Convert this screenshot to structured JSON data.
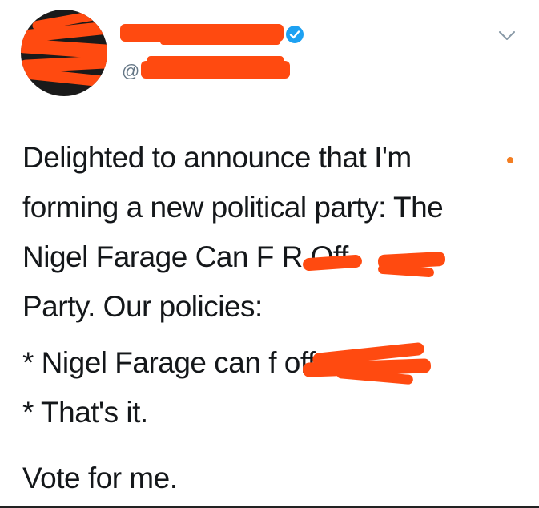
{
  "header": {
    "display_name": "",
    "handle_prefix": "@",
    "handle": ""
  },
  "tweet": {
    "paragraph_1": "Delighted to announce that I'm\nforming a new political party: The\nNigel Farage Can F        R        Off\nParty. Our policies:",
    "paragraph_2": "* Nigel Farage can f                 off.\n* That's it.",
    "paragraph_3": "Vote for me."
  },
  "colors": {
    "redaction": "#ff4a10",
    "verified": "#1da1f2",
    "dot": "#f37e22"
  },
  "icons": {
    "verified": "verified-badge-icon",
    "menu": "chevron-down-icon"
  }
}
